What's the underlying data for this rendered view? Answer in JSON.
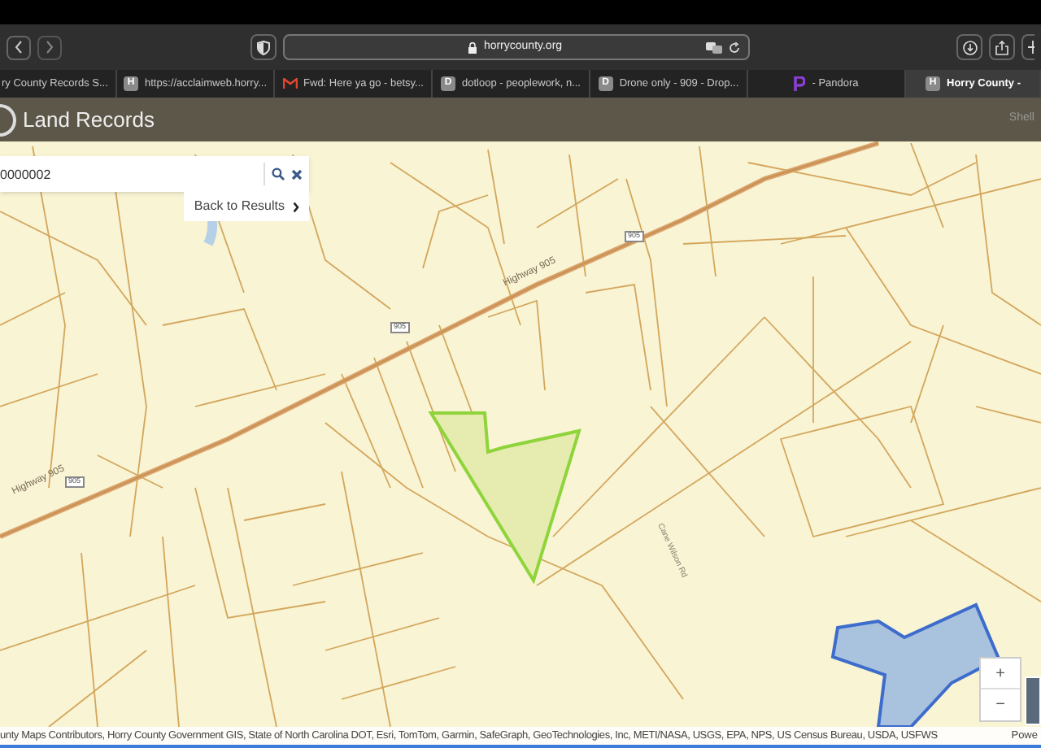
{
  "browser": {
    "url": "horrycounty.org",
    "tabs": [
      {
        "title": "ry County Records S...",
        "kind": "plain",
        "selected": false
      },
      {
        "title": "https://acclaimweb.horry...",
        "kind": "letter",
        "badge": "H",
        "selected": false
      },
      {
        "title": "Fwd: Here ya go - betsy...",
        "kind": "mail",
        "selected": false
      },
      {
        "title": "dotloop - peoplework, n...",
        "kind": "letter",
        "badge": "D",
        "selected": false
      },
      {
        "title": "Drone only - 909 - Drop...",
        "kind": "letter",
        "badge": "D",
        "selected": false
      },
      {
        "title": "- Pandora",
        "kind": "pandora",
        "selected": false
      },
      {
        "title": "Horry County -",
        "kind": "letter",
        "badge": "H",
        "selected": true
      }
    ]
  },
  "header": {
    "title": "Land Records",
    "right_text": "Shell"
  },
  "search": {
    "value": "0000002",
    "back_link": "Back to Results"
  },
  "map": {
    "road_labels": [
      {
        "text": "Highway 905",
        "kind": "highway"
      },
      {
        "text": "Highway 905",
        "kind": "highway"
      },
      {
        "text": "905",
        "kind": "shield"
      },
      {
        "text": "905",
        "kind": "shield"
      },
      {
        "text": "905",
        "kind": "shield"
      },
      {
        "text": "Cane Wilson Rd",
        "kind": "road"
      }
    ],
    "zoom_in": "+",
    "zoom_out": "−"
  },
  "attribution": {
    "text": "unty Maps Contributors, Horry County Government GIS, State of North Carolina DOT, Esri, TomTom, Garmin, SafeGraph, GeoTechnologies, Inc, METI/NASA, USGS, EPA, NPS, US Census Bureau, USDA, USFWS",
    "powered": "Powe"
  }
}
